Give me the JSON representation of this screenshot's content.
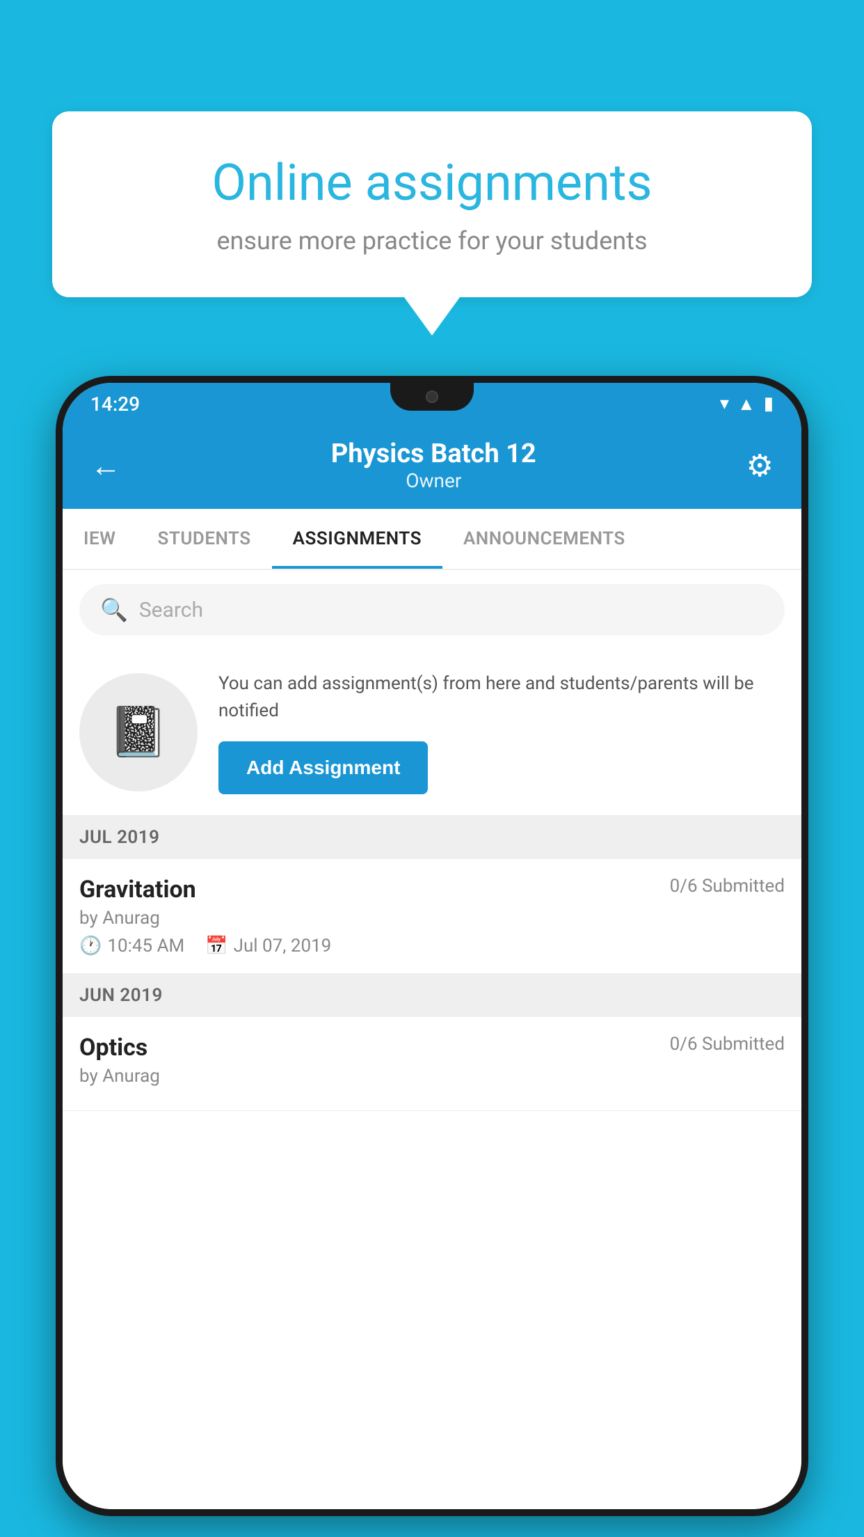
{
  "background_color": "#1ab8e0",
  "speech_bubble": {
    "title": "Online assignments",
    "subtitle": "ensure more practice for your students"
  },
  "phone": {
    "status_bar": {
      "time": "14:29",
      "icons": [
        "wifi",
        "signal",
        "battery"
      ]
    },
    "header": {
      "title": "Physics Batch 12",
      "subtitle": "Owner",
      "back_label": "←",
      "settings_label": "⚙"
    },
    "tabs": [
      {
        "label": "IEW",
        "active": false
      },
      {
        "label": "STUDENTS",
        "active": false
      },
      {
        "label": "ASSIGNMENTS",
        "active": true
      },
      {
        "label": "ANNOUNCEMENTS",
        "active": false
      }
    ],
    "search": {
      "placeholder": "Search"
    },
    "promo": {
      "description": "You can add assignment(s) from here and students/parents will be notified",
      "button_label": "Add Assignment"
    },
    "sections": [
      {
        "label": "JUL 2019",
        "assignments": [
          {
            "name": "Gravitation",
            "submitted": "0/6 Submitted",
            "by": "by Anurag",
            "time": "10:45 AM",
            "date": "Jul 07, 2019"
          }
        ]
      },
      {
        "label": "JUN 2019",
        "assignments": [
          {
            "name": "Optics",
            "submitted": "0/6 Submitted",
            "by": "by Anurag",
            "time": "",
            "date": ""
          }
        ]
      }
    ]
  }
}
